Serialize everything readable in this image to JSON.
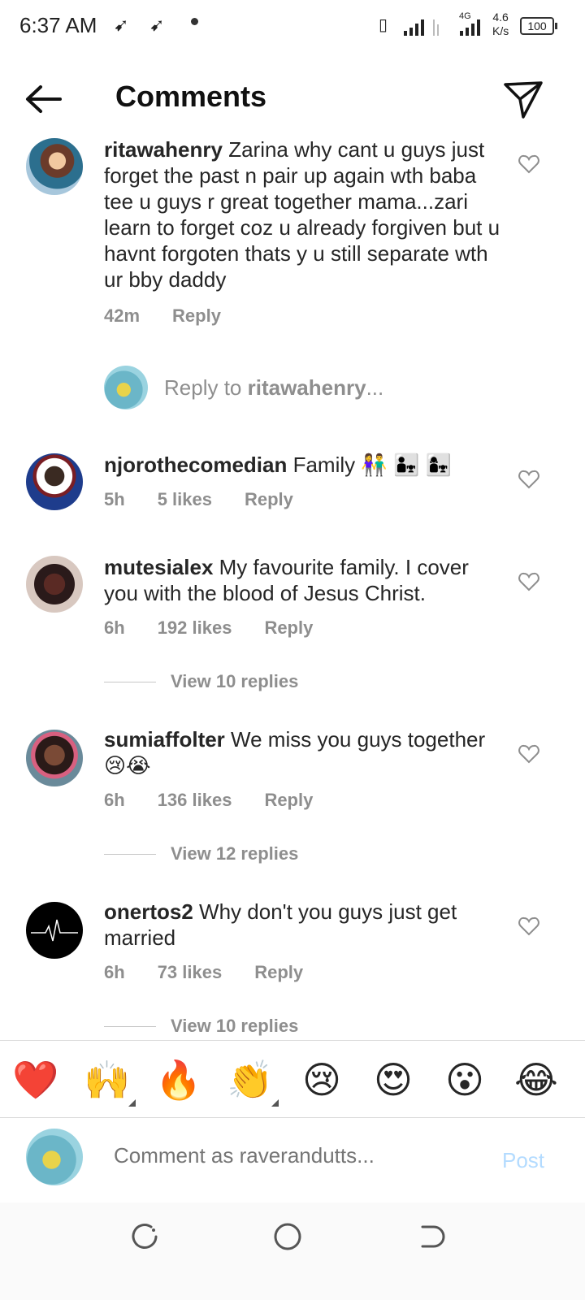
{
  "status_bar": {
    "time": "6:37 AM",
    "network_type": "4G",
    "speed_value": "4.6",
    "speed_unit": "K/s",
    "battery": "100"
  },
  "header": {
    "title": "Comments"
  },
  "comments": [
    {
      "username": "ritawahenry",
      "text": "Zarina why cant u guys just forget the past n pair up again wth baba tee u guys r great together mama...zari learn to forget coz u already forgiven but u havnt forgoten thats y u still separate wth ur bby daddy",
      "time": "42m",
      "likes": "",
      "reply_label": "Reply"
    },
    {
      "username": "njorothecomedian",
      "text": "Family 👫 👨‍👧 👩‍👧",
      "time": "5h",
      "likes": "5 likes",
      "reply_label": "Reply"
    },
    {
      "username": "mutesialex",
      "text": "My favourite family. I cover you with the blood of Jesus Christ.",
      "time": "6h",
      "likes": "192 likes",
      "reply_label": "Reply",
      "view_replies": "View 10 replies"
    },
    {
      "username": "sumiaffolter",
      "text": "We miss you guys together 😢😭",
      "time": "6h",
      "likes": "136 likes",
      "reply_label": "Reply",
      "view_replies": "View 12 replies"
    },
    {
      "username": "onertos2",
      "text": "Why don't you guys just get married",
      "time": "6h",
      "likes": "73 likes",
      "reply_label": "Reply",
      "view_replies": "View 10 replies"
    }
  ],
  "reply_prompt": {
    "prefix": "Reply to ",
    "username": "ritawahenry",
    "suffix": "..."
  },
  "emoji_bar": [
    "❤️",
    "🙌",
    "🔥",
    "👏",
    "😢",
    "😍",
    "😮",
    "😂"
  ],
  "compose": {
    "placeholder": "Comment as raverandutts...",
    "post_label": "Post"
  },
  "colors": {
    "meta_text": "#8e8e8e",
    "post_disabled": "#b3dbff",
    "divider": "#dbdbdb"
  }
}
